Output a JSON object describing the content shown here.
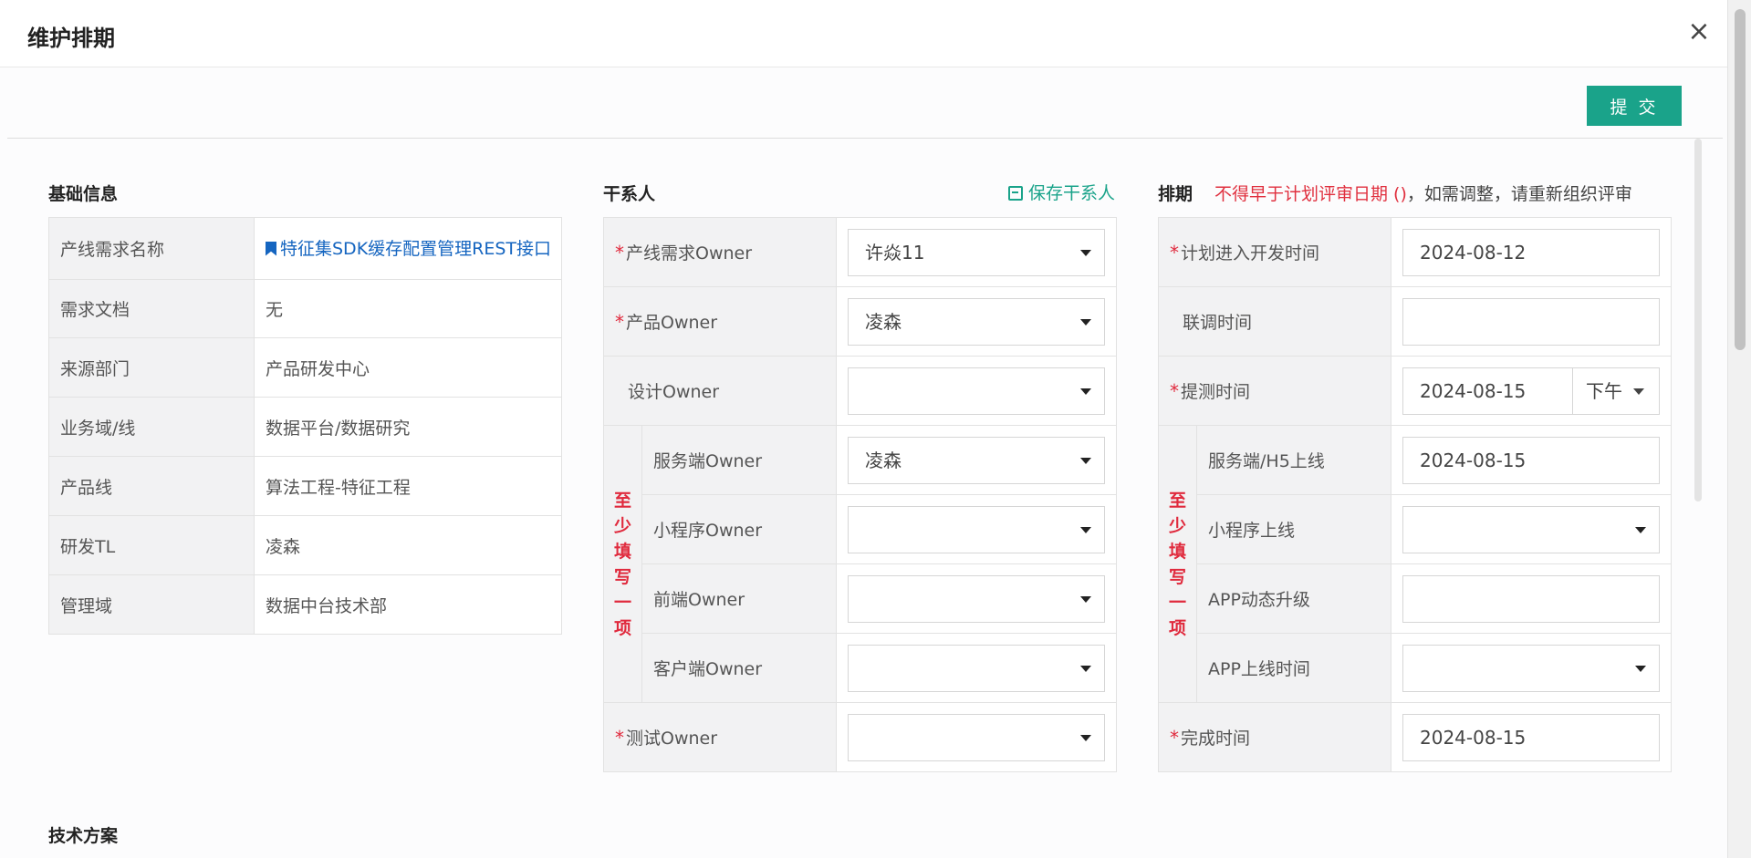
{
  "modal": {
    "title": "维护排期",
    "close_glyph": "×"
  },
  "toolbar": {
    "submit_label": "提 交"
  },
  "basic": {
    "title": "基础信息",
    "rows": [
      {
        "label": "产线需求名称",
        "value": "特征集SDK缓存配置管理REST接口"
      },
      {
        "label": "需求文档",
        "value": "无"
      },
      {
        "label": "来源部门",
        "value": "产品研发中心"
      },
      {
        "label": "业务域/线",
        "value": "数据平台/数据研究"
      },
      {
        "label": "产品线",
        "value": "算法工程-特征工程"
      },
      {
        "label": "研发TL",
        "value": "凌森"
      },
      {
        "label": "管理域",
        "value": "数据中台技术部"
      }
    ]
  },
  "stakeholders": {
    "title": "干系人",
    "save_label": "保存干系人",
    "required_mark": "*",
    "group_label": "至少填写一项",
    "rows": [
      {
        "label": "产线需求Owner",
        "value": "许焱11"
      },
      {
        "label": "产品Owner",
        "value": "凌森"
      },
      {
        "label": "设计Owner",
        "value": ""
      },
      {
        "label": "服务端Owner",
        "value": "凌森"
      },
      {
        "label": "小程序Owner",
        "value": ""
      },
      {
        "label": "前端Owner",
        "value": ""
      },
      {
        "label": "客户端Owner",
        "value": ""
      },
      {
        "label": "测试Owner",
        "value": ""
      }
    ]
  },
  "schedule": {
    "title": "排期",
    "warning": "不得早于计划评审日期 ()",
    "note_rest": "，如需调整，请重新组织评审",
    "group_label": "至少填写一项",
    "rows": [
      {
        "label": "计划进入开发时间",
        "value": "2024-08-12"
      },
      {
        "label": "联调时间",
        "value": ""
      },
      {
        "label": "提测时间",
        "value": "2024-08-15",
        "ampm": "下午"
      },
      {
        "label": "服务端/H5上线",
        "value": "2024-08-15"
      },
      {
        "label": "小程序上线",
        "value": ""
      },
      {
        "label": "APP动态升级",
        "value": ""
      },
      {
        "label": "APP上线时间",
        "value": ""
      },
      {
        "label": "完成时间",
        "value": "2024-08-15"
      }
    ]
  },
  "tech": {
    "title": "技术方案"
  }
}
